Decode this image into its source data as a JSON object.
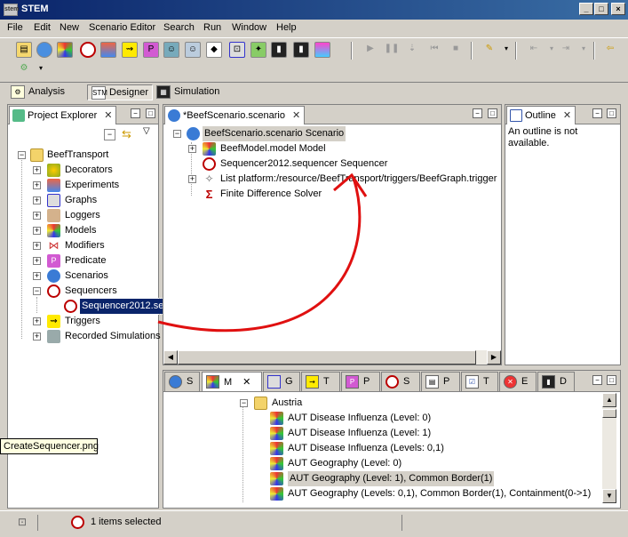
{
  "window": {
    "title": "STEM",
    "app_icon_text": "stem"
  },
  "menu": [
    "File",
    "Edit",
    "New",
    "Scenario Editor",
    "Search",
    "Run",
    "Window",
    "Help"
  ],
  "perspectives": [
    {
      "label": "Analysis",
      "active": false
    },
    {
      "label": "Designer",
      "active": true
    },
    {
      "label": "Simulation",
      "active": false
    }
  ],
  "project_explorer": {
    "tab_label": "Project Explorer",
    "root": "BeefTransport",
    "items": [
      "Decorators",
      "Experiments",
      "Graphs",
      "Loggers",
      "Models",
      "Modifiers",
      "Predicate",
      "Scenarios",
      "Sequencers",
      "Triggers",
      "Recorded Simulations"
    ],
    "selected_child": "Sequencer2012.se"
  },
  "editor": {
    "tab_label": "*BeefScenario.scenario",
    "root": "BeefScenario.scenario Scenario",
    "items": [
      "BeefModel.model Model",
      "Sequencer2012.sequencer Sequencer",
      "List platform:/resource/BeefTransport/triggers/BeefGraph.trigger",
      "Finite Difference Solver"
    ]
  },
  "outline": {
    "tab_label": "Outline",
    "message": "An outline is not available."
  },
  "bottom_tabs": [
    "S",
    "M",
    "G",
    "T",
    "P",
    "S",
    "P",
    "T",
    "E",
    "D"
  ],
  "bottom_tree": {
    "group": "Austria",
    "items": [
      "AUT Disease Influenza (Level: 0)",
      "AUT Disease Influenza (Level: 1)",
      "AUT Disease Influenza (Levels: 0,1)",
      "AUT Geography (Level: 0)",
      "AUT Geography (Level: 1), Common Border(1)",
      "AUT Geography (Levels: 0,1), Common Border(1), Containment(0->1)"
    ]
  },
  "status": {
    "text": "1 items selected"
  },
  "tooltip": "CreateSequencer.png",
  "colors": {
    "titlebar": "#0a246a",
    "selection": "#0a246a",
    "annotation_arrow": "#e01010"
  }
}
